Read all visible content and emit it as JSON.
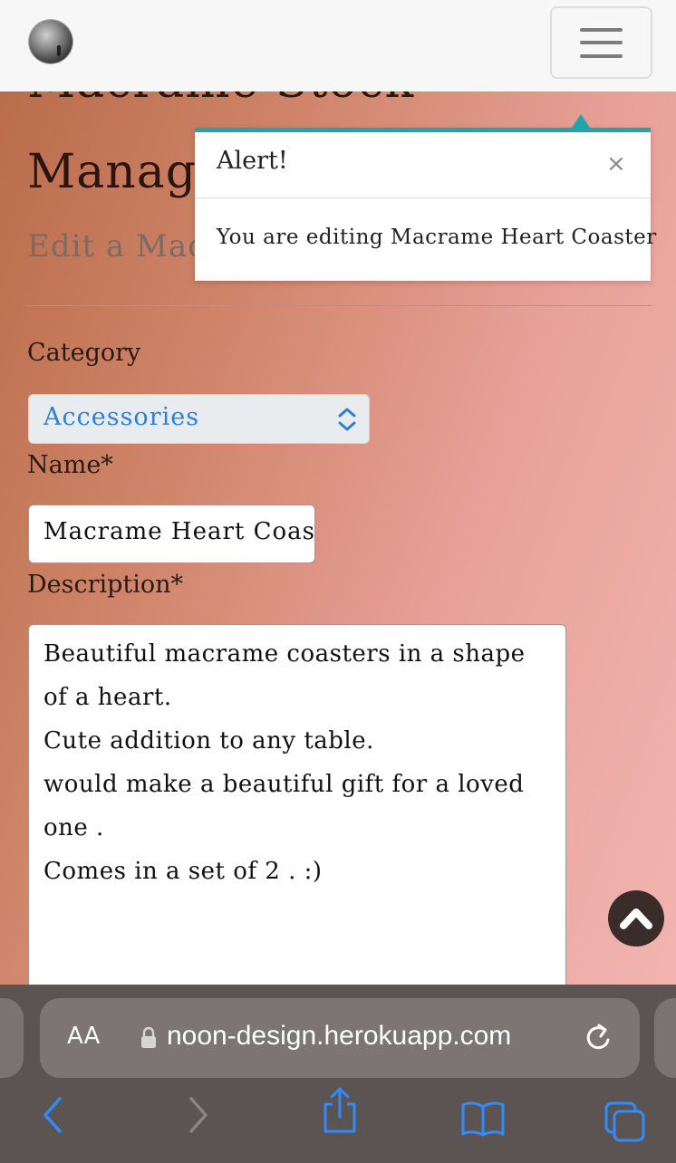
{
  "navbar": {
    "logo_name": "moon-logo",
    "menu_icon": "hamburger-icon"
  },
  "page": {
    "heading_line1": "Macrame Stock",
    "heading_line2": "Manage",
    "subheading": "Edit a Macr"
  },
  "popover": {
    "title": "Alert!",
    "close_label": "×",
    "body": "You are editing Macrame Heart Coaster",
    "accent": "#20a5ae"
  },
  "form": {
    "category": {
      "label": "Category",
      "value": "Accessories"
    },
    "name": {
      "label": "Name*",
      "value": "Macrame Heart Coast"
    },
    "description": {
      "label": "Description*",
      "lines": [
        "Beautiful macrame coasters in a shape",
        "of a heart.",
        "Cute addition to any table.",
        "would make a beautiful gift for a loved",
        "one .",
        "Comes in a set of 2 . :)"
      ]
    }
  },
  "safari": {
    "aa_label": "AA",
    "url": "noon-design.herokuapp.com",
    "icons": [
      "lock-icon",
      "reload-icon",
      "back-icon",
      "forward-icon",
      "share-icon",
      "bookmarks-icon",
      "tabs-icon"
    ]
  },
  "colors": {
    "select_text": "#2e7fd6",
    "safari_blue": "#2f8cff",
    "back_to_top": "#3a2c28"
  }
}
